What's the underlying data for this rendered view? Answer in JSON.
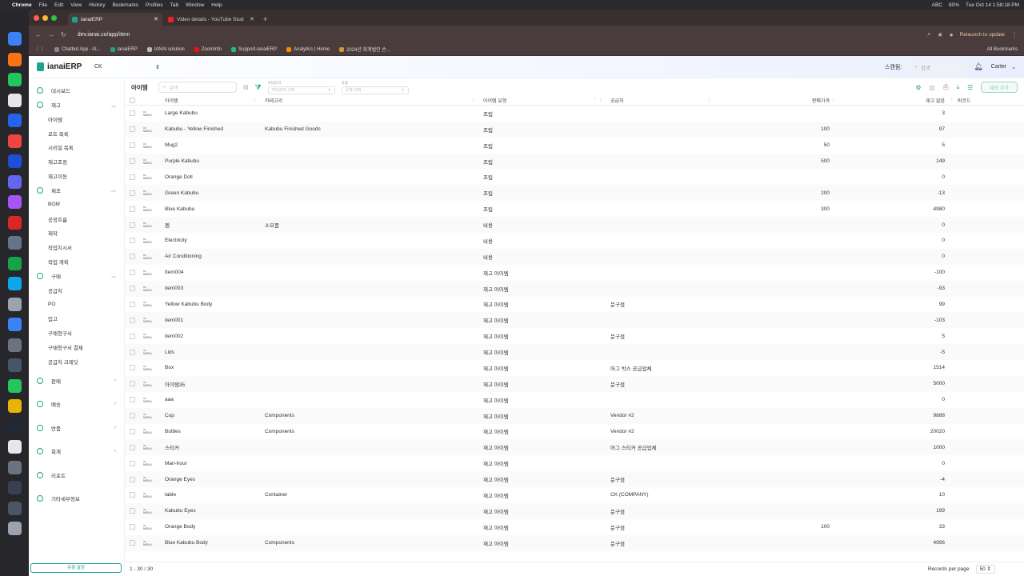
{
  "menubar": {
    "app": "Chrome",
    "items": [
      "File",
      "Edit",
      "View",
      "History",
      "Bookmarks",
      "Profiles",
      "Tab",
      "Window",
      "Help"
    ],
    "battery": "80%",
    "input": "ABC",
    "clock": "Tue Oct 14  1:58:18 PM"
  },
  "browser": {
    "tabs": [
      {
        "title": "ianaiERP",
        "active": true
      },
      {
        "title": "Video details - YouTube Studio",
        "active": false
      }
    ],
    "url": "dev.ianai.co/app/item",
    "relaunch": "Relaunch to update",
    "bookmarks": [
      "Chatbot App - AI...",
      "ianaiERP",
      "IANAI solution",
      "ZoomInfo",
      "Support-ianaiERP",
      "Analytics | Home",
      "2024년 회계법인 손..."
    ],
    "all_bookmarks": "All Bookmarks"
  },
  "app": {
    "brand": "ianaiERP",
    "company": "CK",
    "scan_label": "스캔됨:",
    "search_placeholder": "검색",
    "user": "Carter"
  },
  "sidebar": {
    "dashboard": "대시보드",
    "groups": [
      {
        "label": "재고",
        "open": true,
        "items": [
          "아이템",
          "로트 목록",
          "시리얼 목록",
          "재고조정",
          "재고이동"
        ]
      },
      {
        "label": "제조",
        "open": true,
        "items": [
          "BOM",
          "공정흐름",
          "제작",
          "작업지시서",
          "작업 계획"
        ]
      },
      {
        "label": "구매",
        "open": true,
        "items": [
          "공급처",
          "PO",
          "입고",
          "구매청구서",
          "구매청구서 결제",
          "공급처 크레딧"
        ]
      },
      {
        "label": "판매",
        "open": false,
        "items": []
      },
      {
        "label": "배송",
        "open": false,
        "items": []
      },
      {
        "label": "반품",
        "open": false,
        "items": []
      },
      {
        "label": "회계",
        "open": false,
        "items": []
      },
      {
        "label": "리포트",
        "open": false,
        "items": []
      },
      {
        "label": "기타세부정보",
        "open": false,
        "items": []
      }
    ],
    "bottom_button": "유형 설정"
  },
  "toolbar": {
    "title": "아이템",
    "search_placeholder": "검색",
    "filter_category_label": "카테고리",
    "filter_category_placeholder": "카테고리 선택",
    "filter_type_label": "유형",
    "filter_type_placeholder": "유형 선택",
    "new_button": "새로 추가"
  },
  "table": {
    "headers": [
      "아이템",
      "카테고리",
      "아이템 유형",
      "공급처",
      "판매가격",
      "재고 없음",
      "바코드"
    ],
    "rows": [
      [
        "Large Kabubu",
        "",
        "조립",
        "",
        "",
        "3",
        ""
      ],
      [
        "Kabubu - Yellow Finished",
        "Kabubu Finished Goods",
        "조립",
        "",
        "100",
        "97",
        ""
      ],
      [
        "Mug2",
        "",
        "조립",
        "",
        "50",
        "5",
        ""
      ],
      [
        "Purple Kabubu",
        "",
        "조립",
        "",
        "500",
        "149",
        ""
      ],
      [
        "Orange Doll",
        "",
        "조립",
        "",
        "",
        "0",
        ""
      ],
      [
        "Green Kabubu",
        "",
        "조립",
        "",
        "200",
        "-13",
        ""
      ],
      [
        "Blue Kabubu",
        "",
        "조립",
        "",
        "300",
        "4980",
        ""
      ],
      [
        "펜",
        "소모품",
        "비용",
        "",
        "",
        "0",
        ""
      ],
      [
        "Electricity",
        "",
        "비용",
        "",
        "",
        "0",
        ""
      ],
      [
        "Air Conditioning",
        "",
        "비용",
        "",
        "",
        "0",
        ""
      ],
      [
        "Item004",
        "",
        "재고 아이템",
        "",
        "",
        "-100",
        ""
      ],
      [
        "item003",
        "",
        "재고 아이템",
        "",
        "",
        "-93",
        ""
      ],
      [
        "Yellow Kabubu Body",
        "",
        "재고 아이템",
        "문구점",
        "",
        "99",
        ""
      ],
      [
        "item001",
        "",
        "재고 아이템",
        "",
        "",
        "-103",
        ""
      ],
      [
        "item002",
        "",
        "재고 아이템",
        "문구점",
        "",
        "5",
        ""
      ],
      [
        "Lids",
        "",
        "재고 아이템",
        "",
        "",
        "-5",
        ""
      ],
      [
        "Box",
        "",
        "재고 아이템",
        "머그 박스 공급업체",
        "",
        "1514",
        ""
      ],
      [
        "아이템35",
        "",
        "재고 아이템",
        "문구점",
        "",
        "5000",
        ""
      ],
      [
        "aaa",
        "",
        "재고 아이템",
        "",
        "",
        "0",
        ""
      ],
      [
        "Cup",
        "Components",
        "재고 아이템",
        "Vendor #2",
        "",
        "9888",
        ""
      ],
      [
        "Bottles",
        "Components",
        "재고 아이템",
        "Vendor #2",
        "",
        "20020",
        ""
      ],
      [
        "스티커",
        "",
        "재고 아이템",
        "머그 스티커 공급업체",
        "",
        "1000",
        ""
      ],
      [
        "Man-hour",
        "",
        "재고 아이템",
        "",
        "",
        "0",
        ""
      ],
      [
        "Orange Eyes",
        "",
        "재고 아이템",
        "문구점",
        "",
        "-4",
        ""
      ],
      [
        "table",
        "Container",
        "재고 아이템",
        "CK (COMPANY)",
        "",
        "10",
        ""
      ],
      [
        "Kabubu Eyes",
        "",
        "재고 아이템",
        "문구점",
        "",
        "199",
        ""
      ],
      [
        "Orange Body",
        "",
        "재고 아이템",
        "문구점",
        "100",
        "33",
        ""
      ],
      [
        "Blue Kabubu Body",
        "Components",
        "재고 아이템",
        "문구점",
        "",
        "4996",
        ""
      ]
    ]
  },
  "footer": {
    "range": "1 - 30 / 30",
    "rpp_label": "Records per page",
    "rpp_value": "50"
  }
}
